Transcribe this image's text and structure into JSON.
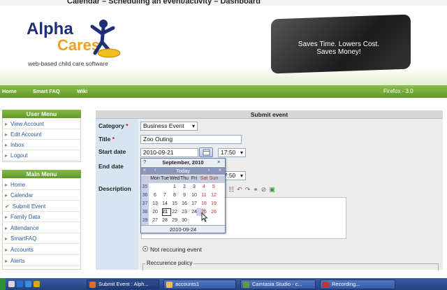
{
  "window": {
    "title": "Calendar – Scheduling an event/activity – Dashboard"
  },
  "logo": {
    "name_line1": "Alpha",
    "name_line2": "Cares",
    "tagline": "web-based child care software"
  },
  "promo": {
    "line1": "Saves Time. Lowers Cost.",
    "line2": "Saves Money!"
  },
  "nav": {
    "home": "Home",
    "smartfaq": "Smart FAQ",
    "wiki": "Wiki",
    "browser": "Firefox - 3.0"
  },
  "user_menu": {
    "title": "User Menu",
    "items": [
      "View Account",
      "Edit Account",
      "Inbox",
      "Logout"
    ]
  },
  "main_menu": {
    "title": "Main Menu",
    "items": [
      "Home",
      "Calendar",
      "Submit Event",
      "Family Data",
      "Attendance",
      "SmartFAQ",
      "Accounts",
      "Alerts"
    ],
    "active": "Submit Event"
  },
  "form": {
    "title": "Submit event",
    "category_label": "Category",
    "category_value": "Business Event",
    "title_label": "Title",
    "title_value": "Zoo Outing",
    "start_label": "Start date",
    "start_date": "2010-09-21",
    "start_time": "17:50",
    "end_label": "End date",
    "end_time": "17:50",
    "description_label": "Description",
    "radio_label": "Not reccuring event",
    "recurrence_label": "Reccurence policy"
  },
  "calendar_popup": {
    "help": "?",
    "month": "September, 2010",
    "close": "×",
    "today": "Today",
    "nav_prev_year": "«",
    "nav_prev": "‹",
    "nav_next": "›",
    "nav_next_year": "»",
    "days": [
      "Mon",
      "Tue",
      "Wed",
      "Thu",
      "Fri",
      "Sat",
      "Sun"
    ],
    "weeks": [
      {
        "n": "35",
        "d": [
          "",
          "",
          "1",
          "2",
          "3",
          "4",
          "5"
        ]
      },
      {
        "n": "36",
        "d": [
          "6",
          "7",
          "8",
          "9",
          "10",
          "11",
          "12"
        ]
      },
      {
        "n": "37",
        "d": [
          "13",
          "14",
          "15",
          "16",
          "17",
          "18",
          "19"
        ]
      },
      {
        "n": "38",
        "d": [
          "20",
          "21",
          "22",
          "23",
          "24",
          "25",
          "26"
        ]
      },
      {
        "n": "39",
        "d": [
          "27",
          "28",
          "29",
          "30",
          "",
          "",
          ""
        ]
      }
    ],
    "today_date": "21",
    "hover_date": "24",
    "footer": "2010-09-24"
  },
  "taskbar": {
    "items": [
      "Submit Event : Alph...",
      "accounts1",
      "Camtasia Studio - c...",
      "Recording..."
    ]
  },
  "colors": {
    "nav_green": "#6aa232",
    "menu_link": "#2a5a9a",
    "label_bg": "#d7e4f2",
    "taskbar_blue": "#2c4d92"
  }
}
